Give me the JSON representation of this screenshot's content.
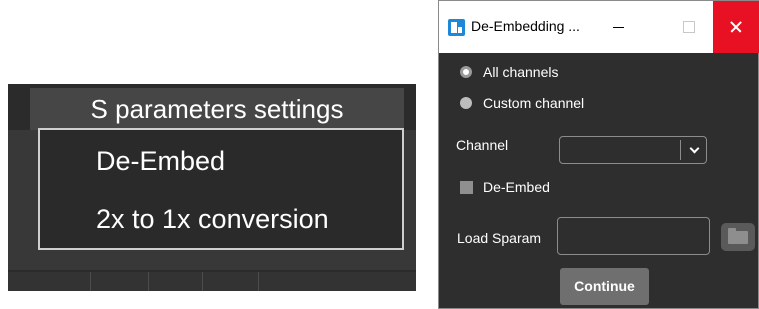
{
  "context_menu": {
    "header_label": "S parameters settings",
    "items": [
      {
        "label": "De-Embed"
      },
      {
        "label": "2x to 1x conversion"
      }
    ]
  },
  "dialog": {
    "title": "De-Embedding ...",
    "radio_options": [
      {
        "label": "All channels",
        "selected": true
      },
      {
        "label": "Custom channel",
        "selected": false
      }
    ],
    "channel_label": "Channel",
    "channel_value": "",
    "de_embed_label": "De-Embed",
    "de_embed_checked": false,
    "load_sparam_label": "Load Sparam",
    "load_sparam_value": "",
    "continue_label": "Continue"
  },
  "icons": [
    "app-icon",
    "minimize-icon",
    "maximize-icon",
    "close-icon",
    "chevron-down-icon",
    "folder-icon"
  ],
  "colors": {
    "dialog_background": "#2e2e2e",
    "close_button": "#e81123",
    "menu_background": "#2a2a2a",
    "menu_header": "#464646"
  }
}
